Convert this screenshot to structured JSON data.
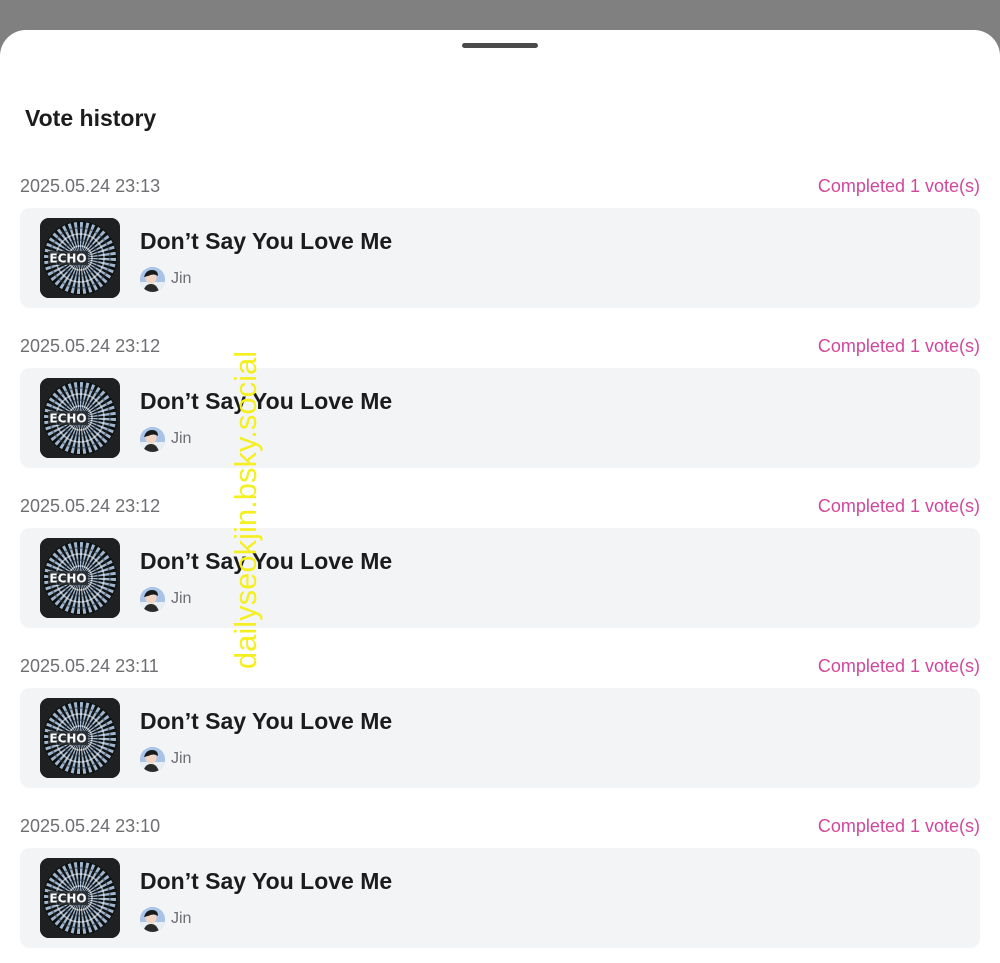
{
  "sheet": {
    "title": "Vote history"
  },
  "history": [
    {
      "timestamp": "2025.05.24 23:13",
      "status": "Completed 1 vote(s)",
      "song": "Don’t Say You Love Me",
      "artist": "Jin",
      "album_text": "ECHO"
    },
    {
      "timestamp": "2025.05.24 23:12",
      "status": "Completed 1 vote(s)",
      "song": "Don’t Say You Love Me",
      "artist": "Jin",
      "album_text": "ECHO"
    },
    {
      "timestamp": "2025.05.24 23:12",
      "status": "Completed 1 vote(s)",
      "song": "Don’t Say You Love Me",
      "artist": "Jin",
      "album_text": "ECHO"
    },
    {
      "timestamp": "2025.05.24 23:11",
      "status": "Completed 1 vote(s)",
      "song": "Don’t Say You Love Me",
      "artist": "Jin",
      "album_text": "ECHO"
    },
    {
      "timestamp": "2025.05.24 23:10",
      "status": "Completed 1 vote(s)",
      "song": "Don’t Say You Love Me",
      "artist": "Jin",
      "album_text": "ECHO"
    }
  ],
  "watermark": "dailyseokjin.bsky.social",
  "colors": {
    "status": "#d0479a",
    "card_background": "#f3f4f6",
    "watermark": "#f5ef1f"
  }
}
